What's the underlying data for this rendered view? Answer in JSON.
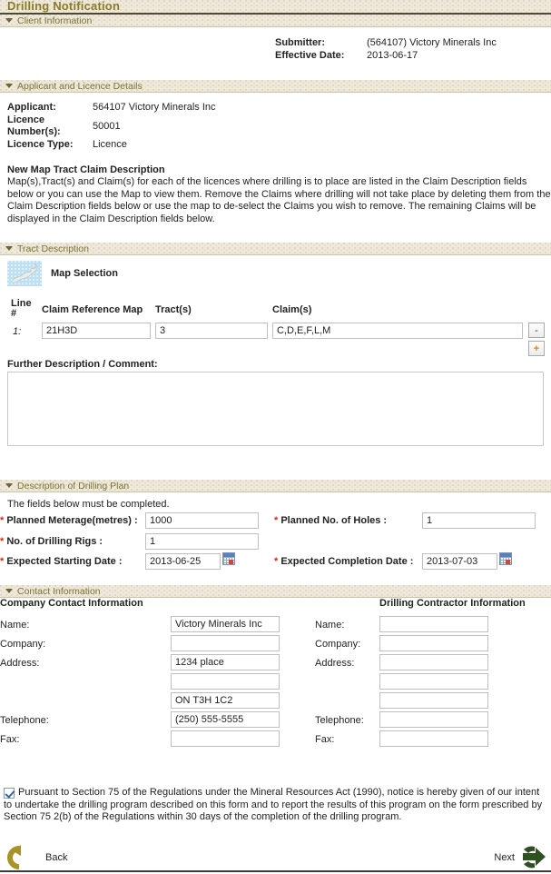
{
  "page": {
    "title": "Drilling Notification"
  },
  "sections": {
    "client": {
      "header": "Client Information"
    },
    "applicant": {
      "header": "Applicant and Licence Details"
    },
    "tract": {
      "header": "Tract Description"
    },
    "plan": {
      "header": "Description of Drilling Plan"
    },
    "contact": {
      "header": "Contact Information"
    }
  },
  "client": {
    "submitter_label": "Submitter:",
    "submitter_value": "(564107) Victory Minerals Inc",
    "effective_date_label": "Effective Date:",
    "effective_date_value": "2013-06-17"
  },
  "applicant": {
    "applicant_label": "Applicant:",
    "applicant_value": "564107 Victory Minerals Inc",
    "licence_numbers_label": "Licence Number(s):",
    "licence_numbers_value": "50001",
    "licence_type_label": "Licence Type:",
    "licence_type_value": "Licence",
    "claim_desc_title": "New Map Tract Claim Description",
    "claim_desc_text": "Map(s),Tract(s) and Claim(s) for each of the licences where drilling is to place are listed in the Claim Description fields below or you can use the Map to view them. Remove the Claims where drilling will not take place by deleting them from the Claim Description fields below or use the map to de-select the Claims you wish to remove. The remaining Claims will be displayed in the Claim Description fields below."
  },
  "tract": {
    "map_selection_label": "Map Selection",
    "columns": {
      "line_line": "Line",
      "line_hash": "#",
      "claim_reference_map": "Claim Reference Map",
      "tracts": "Tract(s)",
      "claims": "Claim(s)"
    },
    "row": {
      "line_number": "1:",
      "claim_reference_map": "21H3D",
      "tracts": "3",
      "claims": "C,D,E,F,L,M"
    },
    "remove_row_label": "-",
    "add_row_label": "+",
    "further_description_label": "Further Description / Comment:",
    "further_description_value": ""
  },
  "plan": {
    "note": "The fields below must be completed.",
    "required_marker": "*",
    "planned_meterage_label": "Planned Meterage(metres) :",
    "planned_meterage_value": "1000",
    "planned_holes_label": "Planned No. of Holes :",
    "planned_holes_value": "1",
    "drilling_rigs_label": "No. of Drilling Rigs :",
    "drilling_rigs_value": "1",
    "start_date_label": "Expected Starting Date :",
    "start_date_value": "2013-06-25",
    "completion_date_label": "Expected Completion Date :",
    "completion_date_value": "2013-07-03"
  },
  "contact": {
    "company_heading": "Company Contact Information",
    "contractor_heading": "Drilling Contractor Information",
    "labels": {
      "name": "Name:",
      "company": "Company:",
      "address": "Address:",
      "telephone": "Telephone:",
      "fax": "Fax:"
    },
    "company": {
      "name": "Victory Minerals Inc",
      "company": "",
      "address1": "1234 place",
      "address2": "",
      "address3": "ON T3H 1C2",
      "telephone": "(250) 555-5555",
      "fax": ""
    },
    "contractor": {
      "name": "",
      "company": "",
      "address1": "",
      "address2": "",
      "address3": "",
      "telephone": "",
      "fax": ""
    }
  },
  "declaration": {
    "checked": true,
    "text": "Pursuant to Section 75 of the Regulations under the Mineral Resources Act (1990), notice is hereby given of our intent to undertake the drilling program described on this form and to report the results of this program on the form prescribed by Section 75 2(b) of the Regulations within 30 days of the completion of the drilling program."
  },
  "navigation": {
    "back_label": "Back",
    "next_label": "Next"
  },
  "colors": {
    "title_text": "#8a7b27",
    "section_header_text": "#7d7336",
    "section_header_bg": "#edeadb",
    "required_marker": "#d42a18",
    "back_arrow": "#a99326",
    "next_arrow": "#2f5122",
    "map_thumb_bg": "#bfe0f2",
    "plus_button": "#e08214"
  }
}
